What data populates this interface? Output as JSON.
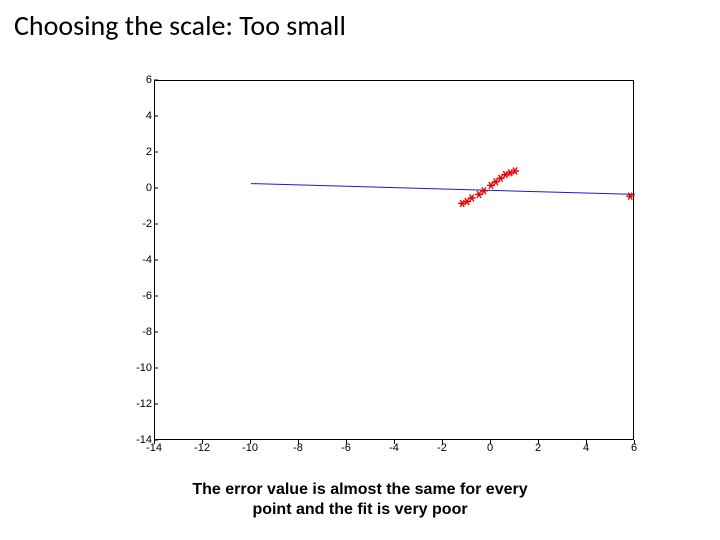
{
  "title": "Choosing the scale: Too small",
  "caption_line1": "The error value is almost the same for every",
  "caption_line2": "point and the fit is very poor",
  "chart_data": {
    "type": "scatter",
    "xlabel": "",
    "ylabel": "",
    "xlim": [
      -14,
      6
    ],
    "ylim": [
      -14,
      6
    ],
    "x_ticks": [
      -14,
      -12,
      -10,
      -8,
      -6,
      -4,
      -2,
      0,
      2,
      4,
      6
    ],
    "y_ticks": [
      -14,
      -12,
      -10,
      -8,
      -6,
      -4,
      -2,
      0,
      2,
      4,
      6
    ],
    "series": [
      {
        "name": "fit-line",
        "type": "line",
        "color": "#1a1ad6",
        "points": [
          {
            "x": -10,
            "y": 0.3
          },
          {
            "x": 6,
            "y": -0.3
          }
        ]
      },
      {
        "name": "data-points",
        "type": "scatter",
        "marker": "*",
        "color": "#e60000",
        "points": [
          {
            "x": -1.2,
            "y": -0.8
          },
          {
            "x": -1.0,
            "y": -0.7
          },
          {
            "x": -0.8,
            "y": -0.5
          },
          {
            "x": -0.5,
            "y": -0.3
          },
          {
            "x": -0.3,
            "y": -0.1
          },
          {
            "x": 0.0,
            "y": 0.2
          },
          {
            "x": 0.2,
            "y": 0.4
          },
          {
            "x": 0.4,
            "y": 0.6
          },
          {
            "x": 0.6,
            "y": 0.8
          },
          {
            "x": 0.8,
            "y": 0.9
          },
          {
            "x": 1.0,
            "y": 1.0
          },
          {
            "x": 5.8,
            "y": -0.4
          }
        ]
      }
    ]
  }
}
